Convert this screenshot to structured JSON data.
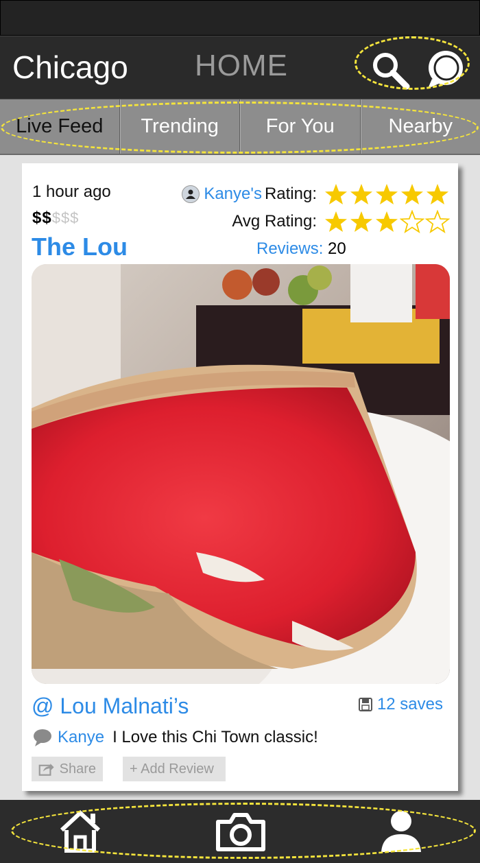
{
  "header": {
    "city": "Chicago",
    "title": "HOME"
  },
  "tabs": [
    {
      "label": "Live Feed",
      "active": true
    },
    {
      "label": "Trending",
      "active": false
    },
    {
      "label": "For You",
      "active": false
    },
    {
      "label": "Nearby",
      "active": false
    }
  ],
  "post": {
    "time_ago": "1 hour ago",
    "price_active": "$$",
    "price_inactive": "$$$",
    "restaurant": "The Lou",
    "user_rating_name": "Kanye's",
    "user_rating_label": "Rating:",
    "user_rating_value": 5,
    "avg_rating_label": "Avg Rating:",
    "avg_rating_value": 3,
    "rating_max": 5,
    "reviews_label": "Reviews:",
    "reviews_count": "20",
    "location": "@ Lou Malnati’s",
    "saves": "12 saves",
    "comment_author": "Kanye",
    "comment_text": "I Love this Chi Town classic!",
    "share_label": "Share",
    "add_review_label": "+ Add Review"
  },
  "colors": {
    "accent_blue": "#2d8be6",
    "star_yellow": "#f7c900",
    "highlight_yellow": "#f4e43c",
    "header_dark": "#2a2a2a",
    "tab_gray": "#8d8d8d"
  },
  "icons": {
    "search": "search-icon",
    "chat": "chat-bubble-icon",
    "home": "home-icon",
    "camera": "camera-icon",
    "profile": "profile-icon",
    "save": "floppy-save-icon",
    "comment": "speech-bubble-icon",
    "share": "share-icon"
  }
}
